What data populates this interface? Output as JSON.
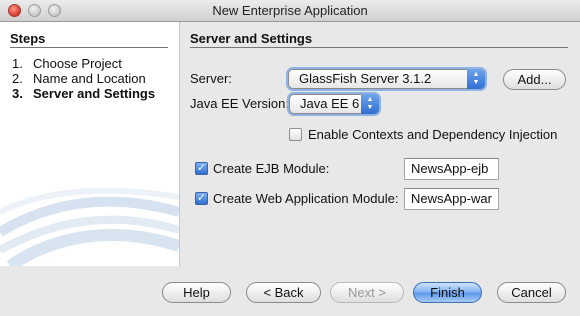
{
  "window": {
    "title": "New Enterprise Application"
  },
  "steps": {
    "title": "Steps",
    "items": [
      {
        "num": "1.",
        "label": "Choose Project",
        "current": false
      },
      {
        "num": "2.",
        "label": "Name and Location",
        "current": false
      },
      {
        "num": "3.",
        "label": "Server and Settings",
        "current": true
      }
    ]
  },
  "panel": {
    "title": "Server and Settings",
    "server": {
      "label": "Server:",
      "value": "GlassFish Server 3.1.2",
      "add_label": "Add..."
    },
    "java_ee": {
      "label": "Java EE Version:",
      "value": "Java EE 6"
    },
    "cdi": {
      "label": "Enable Contexts and Dependency Injection",
      "checked": false
    },
    "ejb": {
      "label": "Create EJB Module:",
      "checked": true,
      "value": "NewsApp-ejb"
    },
    "web": {
      "label": "Create Web Application Module:",
      "checked": true,
      "value": "NewsApp-war"
    }
  },
  "buttons": {
    "help": "Help",
    "back": "< Back",
    "next": "Next >",
    "finish": "Finish",
    "cancel": "Cancel"
  },
  "icons": {
    "close": "close-icon",
    "minimize": "minimize-icon",
    "zoom": "zoom-icon",
    "popup_arrows": "up-down-arrows-icon"
  },
  "colors": {
    "accent": "#3f82dd",
    "default_button": "#6aa3ee"
  }
}
